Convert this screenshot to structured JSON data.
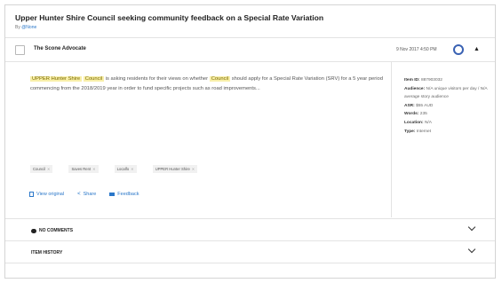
{
  "article": {
    "title": "Upper Hunter Shire Council seeking community feedback on a Special Rate Variation",
    "byline_prefix": "By",
    "author": "@None"
  },
  "source_row": {
    "source": "The Scone Advocate",
    "datetime": "9 Nov 2017 4:50 PM"
  },
  "body": {
    "hl_1": "UPPER Hunter Shire",
    "hl_2": "Council",
    "text_1": "is asking residents for their views on whether",
    "hl_3": "Council",
    "text_2": "should apply for a Special Rate Variation (SRV) for a 5 year period commencing from the 2018/2019 year in order to fund specific projects such as road improvements..."
  },
  "tags": [
    "Council",
    "Saves Rent",
    "Localfo",
    "UPPER Hunter Shire"
  ],
  "actions": {
    "view_original": "View original",
    "share": "Share",
    "feedback": "Feedback"
  },
  "meta": {
    "item_id_label": "Item ID:",
    "item_id": "887903032",
    "audience_label": "Audience:",
    "audience": "N/A unique visitors per day / N/A average story audience",
    "asr_label": "ASR:",
    "asr": "$55 AUD",
    "words_label": "Words:",
    "words": "235",
    "location_label": "Location:",
    "location": "N/A",
    "type_label": "Type:",
    "type": "Internet"
  },
  "sections": {
    "comments": "NO COMMENTS",
    "history": "ITEM HISTORY"
  },
  "colors": {
    "accent": "#2a77c9",
    "highlight": "#f8efa9",
    "ring": "#3a62b3"
  }
}
